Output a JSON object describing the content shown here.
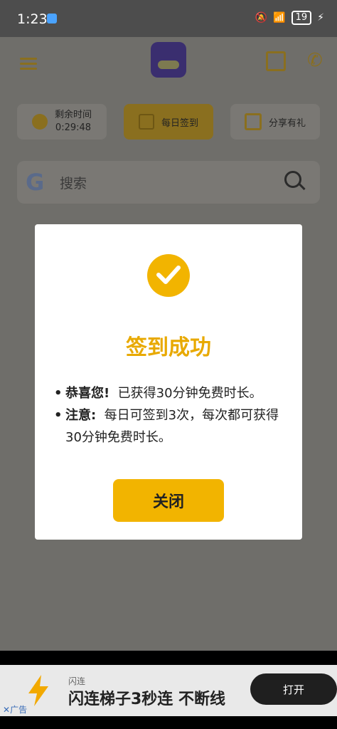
{
  "status": {
    "time": "1:23",
    "battery": "19"
  },
  "app": {
    "timer_label": "剩余时间",
    "timer_value": "0:29:48",
    "checkin_label": "每日签到",
    "share_label": "分享有礼",
    "search_placeholder": "搜索"
  },
  "dialog": {
    "title": "签到成功",
    "bullet1_head": "恭喜您!",
    "bullet1_body": "已获得30分钟免费时长。",
    "bullet2_head": "注意:",
    "bullet2_body": "每日可签到3次，每次都可获得30分钟免费时长。",
    "close_label": "关闭"
  },
  "ad": {
    "brand": "闪连",
    "title": "闪连梯子3秒连 不断线",
    "button": "打开",
    "label": "广告"
  },
  "colors": {
    "accent": "#f2b400",
    "title": "#e8a900"
  }
}
